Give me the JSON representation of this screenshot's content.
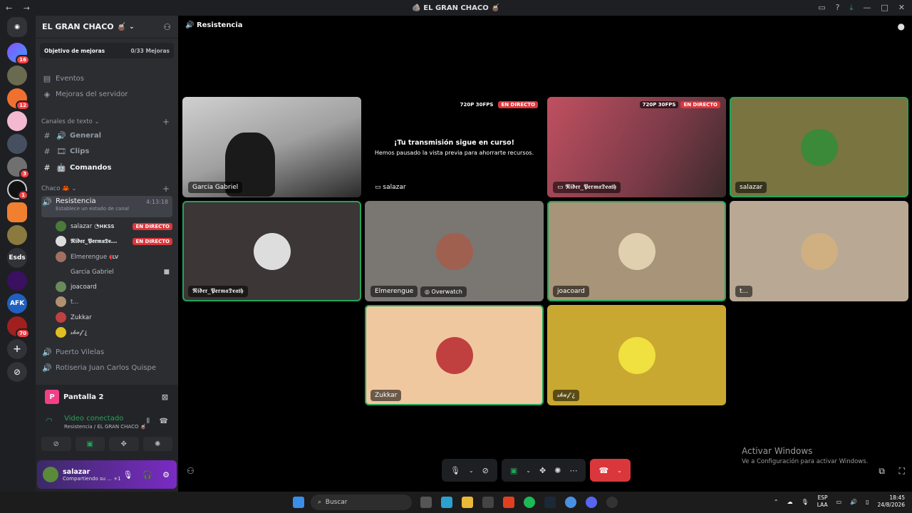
{
  "window": {
    "title": "🪨 EL GRAN CHACO 🧉"
  },
  "guild": {
    "name": "EL GRAN CHACO 🧉",
    "boost_label": "Objetivo de mejoras",
    "boost_progress": "0/33 Mejoras"
  },
  "nav": {
    "events": "Eventos",
    "boosts": "Mejoras del servidor"
  },
  "text_category": "Canales de texto",
  "text_channels": [
    {
      "name": "General",
      "icon": "speaker-icon"
    },
    {
      "name": "Clips",
      "icon": "clips-icon"
    },
    {
      "name": "Comandos",
      "icon": "bot-icon"
    }
  ],
  "voice_category": "Chaco 🦀",
  "active_voice": {
    "name": "Resistencia",
    "timer": "4:13:18",
    "status_prompt": "Establece un estado de canal"
  },
  "voice_members": [
    {
      "name": "salazar",
      "activity": "HKSS",
      "live": "EN DIRECTO",
      "color": "#4a7a3a"
    },
    {
      "name": "𝕽𝖎𝖉𝖊𝖗_𝕻𝖊𝖗𝖒𝖆𝕯𝖊…",
      "activity": "",
      "live": "EN DIRECTO",
      "color": "#ddd"
    },
    {
      "name": "Elmerengue",
      "activity": "LV",
      "live": "",
      "color": "#a07060"
    },
    {
      "name": "Garcia Gabriel",
      "activity": "",
      "live": "",
      "color": "#2b2d31"
    },
    {
      "name": "joacoard",
      "activity": "",
      "live": "",
      "color": "#6a8a5a"
    },
    {
      "name": "t...",
      "activity": "",
      "live": "",
      "color": "#b09070"
    },
    {
      "name": "Zukkar",
      "activity": "",
      "live": "",
      "color": "#c04040"
    },
    {
      "name": "𝓈𝒽𝓊𝒻 ¿",
      "activity": "",
      "live": "",
      "color": "#e0c020"
    }
  ],
  "other_voice": [
    "Puerto Vilelas",
    "Rotiseria Juan Carlos Quispe"
  ],
  "screen_panel": {
    "initial": "P",
    "title": "Pantalla 2"
  },
  "voice_status": {
    "title": "Video conectado",
    "location": "Resistencia / EL GRAN CHACO 🧉"
  },
  "user": {
    "name": "salazar",
    "status": "Compartiendo su ...",
    "extra": "+1"
  },
  "stage": {
    "channel": "Resistencia"
  },
  "tiles": [
    {
      "name": "Garcia Gabriel",
      "kind": "camera",
      "bg": "#3a3a3a",
      "speak": false
    },
    {
      "name": "salazar",
      "kind": "paused",
      "bg": "#000000",
      "speak": false,
      "quality": "720P 30FPS",
      "live": "EN DIRECTO"
    },
    {
      "name": "𝕽𝖎𝖉𝖊𝖗_𝕻𝖊𝖗𝖒𝖆𝕯𝖊𝖆𝖙𝖍",
      "kind": "stream",
      "bg": "#8a4a55",
      "speak": false,
      "quality": "720P 30FPS",
      "live": "EN DIRECTO"
    },
    {
      "name": "salazar",
      "kind": "avatar",
      "bg": "#7a7440",
      "speak": true,
      "av": "#3a8a3a"
    },
    {
      "name": "𝕽𝖎𝖉𝖊𝖗_𝕻𝖊𝖗𝖒𝖆𝕯𝖊𝖆𝖙𝖍",
      "kind": "avatar",
      "bg": "#3c3636",
      "speak": true,
      "av": "#dddddd"
    },
    {
      "name": "Elmerengue",
      "kind": "avatar",
      "bg": "#7a7672",
      "speak": false,
      "av": "#a06050",
      "game": "Overwatch"
    },
    {
      "name": "joacoard",
      "kind": "avatar",
      "bg": "#a89478",
      "speak": true,
      "av": "#e0d0b0"
    },
    {
      "name": "t...",
      "kind": "avatar",
      "bg": "#b8a894",
      "speak": false,
      "av": "#d0b080"
    },
    {
      "name": "Zukkar",
      "kind": "avatar",
      "bg": "#f0c8a0",
      "speak": true,
      "av": "#c04040"
    },
    {
      "name": "𝓈𝒽𝓊𝒻 ¿",
      "kind": "avatar",
      "bg": "#c8a830",
      "speak": false,
      "av": "#f0e040"
    }
  ],
  "paused_text": {
    "title": "¡Tu transmisión sigue en curso!",
    "body": "Hemos pausado la vista previa para ahorrarte recursos."
  },
  "watermark": {
    "title": "Activar Windows",
    "body": "Ve a Configuración para activar Windows."
  },
  "taskbar": {
    "search": "Buscar",
    "lang1": "ESP",
    "lang2": "LAA",
    "time": "18:45",
    "date": "24/8/2026"
  },
  "colors": {
    "accent_green": "#23a55a",
    "live_red": "#da373c",
    "sidebar": "#2b2d31"
  }
}
